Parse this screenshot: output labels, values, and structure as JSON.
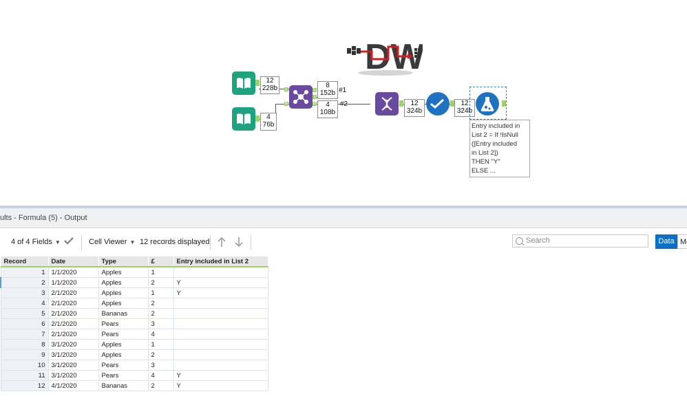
{
  "canvas": {
    "logo_text": "DW",
    "tools": [
      {
        "id": "input1",
        "count": "12",
        "size": "228b"
      },
      {
        "id": "input2",
        "count": "4",
        "size": "76b"
      },
      {
        "id": "join_j",
        "count": "8",
        "size": "152b",
        "tag": "#1"
      },
      {
        "id": "join_r",
        "count": "4",
        "size": "108b",
        "tag": "#2"
      },
      {
        "id": "multirow",
        "count": "12",
        "size": "324b"
      },
      {
        "id": "select",
        "count": "12",
        "size": "324b"
      }
    ],
    "join_anchors": [
      "L",
      "J",
      "R"
    ],
    "join_input_anchors": [
      "L",
      "R"
    ],
    "annotation": [
      "Entry included in",
      "List 2 = If !IsNull",
      "([Entry included",
      "in List 2])",
      "THEN \"Y\"",
      "ELSE ..."
    ],
    "colors": {
      "book": "#1da37f",
      "join": "#6a4aa0",
      "multirow": "#6a4aa0",
      "formula": "#1f72c0",
      "select": "#1f72c0",
      "anchor": "#9fd36a"
    }
  },
  "results": {
    "title": "ults - Formula (5) - Output",
    "fields_label": "4 of 4 Fields",
    "viewer_label": "Cell Viewer",
    "records_label": "12 records displayed",
    "search_placeholder": "Search",
    "data_button": "Data",
    "meta_button": "Me",
    "columns": [
      "Record",
      "Date",
      "Type",
      "£",
      "Entry included in List 2"
    ],
    "rows": [
      [
        "1",
        "1/1/2020",
        "Apples",
        "1",
        ""
      ],
      [
        "2",
        "1/1/2020",
        "Apples",
        "2",
        "Y"
      ],
      [
        "3",
        "2/1/2020",
        "Apples",
        "1",
        "Y"
      ],
      [
        "4",
        "2/1/2020",
        "Apples",
        "2",
        ""
      ],
      [
        "5",
        "2/1/2020",
        "Bananas",
        "2",
        ""
      ],
      [
        "6",
        "2/1/2020",
        "Pears",
        "3",
        ""
      ],
      [
        "7",
        "2/1/2020",
        "Pears",
        "4",
        ""
      ],
      [
        "8",
        "3/1/2020",
        "Apples",
        "1",
        ""
      ],
      [
        "9",
        "3/1/2020",
        "Apples",
        "2",
        ""
      ],
      [
        "10",
        "3/1/2020",
        "Pears",
        "3",
        ""
      ],
      [
        "11",
        "3/1/2020",
        "Pears",
        "4",
        "Y"
      ],
      [
        "12",
        "4/1/2020",
        "Bananas",
        "2",
        "Y"
      ]
    ]
  }
}
